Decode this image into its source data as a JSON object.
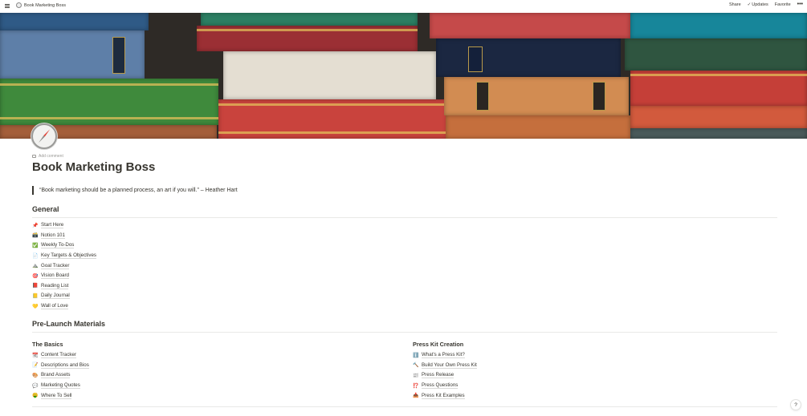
{
  "topbar": {
    "page_title": "Book Marketing Boss",
    "share_label": "Share",
    "updates_label": "Updates",
    "favorite_label": "Favorite",
    "more_label": "•••"
  },
  "page": {
    "add_comment": "Add comment",
    "title": "Book Marketing Boss",
    "quote": "“Book marketing should be a planned process, an art if you will.” – Heather Hart"
  },
  "general": {
    "heading": "General",
    "items": [
      {
        "emoji": "📌",
        "label": "Start Here"
      },
      {
        "emoji": "🗃️",
        "label": "Notion 101"
      },
      {
        "emoji": "✅",
        "label": "Weekly To-Dos"
      },
      {
        "emoji": "📄",
        "label": "Key Targets & Objectives"
      },
      {
        "emoji": "⛰️",
        "label": "Goal Tracker"
      },
      {
        "emoji": "🎯",
        "label": "Vision Board"
      },
      {
        "emoji": "📕",
        "label": "Reading List"
      },
      {
        "emoji": "📒",
        "label": "Daily Journal"
      },
      {
        "emoji": "💛",
        "label": "Wall of Love"
      }
    ]
  },
  "prelaunch": {
    "heading": "Pre-Launch Materials",
    "basics": {
      "heading": "The Basics",
      "items": [
        {
          "emoji": "📆",
          "label": "Content Tracker"
        },
        {
          "emoji": "📝",
          "label": "Descriptions and Bios"
        },
        {
          "emoji": "🎨",
          "label": "Brand Assets"
        },
        {
          "emoji": "💬",
          "label": "Marketing Quotes"
        },
        {
          "emoji": "🤑",
          "label": "Where To Sell"
        }
      ]
    },
    "presskit": {
      "heading": "Press Kit Creation",
      "items": [
        {
          "emoji": "ℹ️",
          "label": "What's a Press Kit?"
        },
        {
          "emoji": "🔨",
          "label": "Build Your Own Press Kit"
        },
        {
          "emoji": "📰",
          "label": "Press Release"
        },
        {
          "emoji": "⁉️",
          "label": "Press Questions"
        },
        {
          "emoji": "📥",
          "label": "Press Kit Examples"
        }
      ]
    }
  },
  "help_label": "?",
  "colors": {
    "text": "#37352f",
    "muted": "#9b9a97",
    "divider": "#e9e9e7"
  }
}
